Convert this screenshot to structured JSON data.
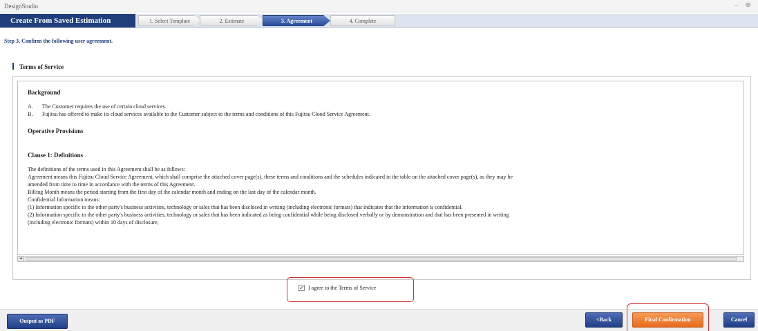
{
  "window": {
    "app_title": "DesignStudio",
    "controls": "– ⊕"
  },
  "wizard": {
    "title": "Create From Saved Estimation",
    "steps": [
      {
        "label": "1. Select Template"
      },
      {
        "label": "2. Estimate"
      },
      {
        "label": "3. Agreement"
      },
      {
        "label": "4. Complete"
      }
    ]
  },
  "step_heading": "Step 3. Confirm the following user agreement.",
  "section_title": "Terms of Service",
  "tos": {
    "background_heading": "Background",
    "background_items": [
      {
        "label": "A.",
        "text": "The Customer requires the use of certain cloud services."
      },
      {
        "label": "B.",
        "text": "Fujitsu has offered to make its cloud services available to the Customer subject to the terms and conditions of this Fujitsu Cloud Service Agreement."
      }
    ],
    "operative_heading": "Operative Provisions",
    "clause_heading": "Clause 1: Definitions",
    "lines": [
      "The definitions of the terms used in this Agreement shall be as follows:",
      "Agreement means this Fujitsu Cloud Service Agreement, which shall comprise the attached cover page(s), these terms and conditions and the schedules indicated in the table on the attached cover page(s), as they may be",
      "amended from time to time in accordance with the terms of this Agreement.",
      "Billing Month means the period starting from the first day of the calendar month and ending on the last day of the calendar month.",
      "Confidential Information means:",
      "(1) Information specific to the other party's business activities, technology or sales that has been disclosed in writing (including electronic formats) that indicates that the information is confidential,",
      "(2) Information specific to the other party's business activities, technology or sales that has been indicated as being confidential while being disclosed verbally or by demonstration and that has been presented in writing",
      "(including electronic formats) within 10 days of disclosure,"
    ]
  },
  "scroll_left_glyph": "◂",
  "agree": {
    "checked": true,
    "check_glyph": "✓",
    "label": "I agree to the Terms of Service"
  },
  "buttons": {
    "output_pdf": "Output as PDF",
    "back": "<Back",
    "final": "Final Confirmation",
    "cancel": "Cancel"
  },
  "colors": {
    "brand_navy": "#1f3f7a",
    "accent_orange": "#e86b1e",
    "highlight_red": "#d42c2c"
  }
}
